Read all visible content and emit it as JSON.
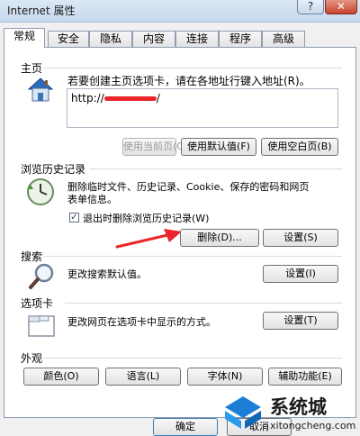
{
  "window": {
    "title": "Internet 属性",
    "help_glyph": "?",
    "close_glyph": "✕"
  },
  "tabs": [
    {
      "label": "常规",
      "active": true
    },
    {
      "label": "安全",
      "active": false
    },
    {
      "label": "隐私",
      "active": false
    },
    {
      "label": "内容",
      "active": false
    },
    {
      "label": "连接",
      "active": false
    },
    {
      "label": "程序",
      "active": false
    },
    {
      "label": "高级",
      "active": false
    }
  ],
  "homepage": {
    "title": "主页",
    "instruction": "若要创建主页选项卡，请在各地址行键入地址(R)。",
    "url_value": "http://",
    "url_suffix": "/",
    "buttons": {
      "use_current": "使用当前页(C)",
      "use_default": "使用默认值(F)",
      "use_blank": "使用空白页(B)"
    }
  },
  "history": {
    "title": "浏览历史记录",
    "description_line1": "删除临时文件、历史记录、Cookie、保存的密码和网页",
    "description_line2": "表单信息。",
    "checkbox_label": "退出时删除浏览历史记录(W)",
    "checkbox_checked": true,
    "checkmark": "✓",
    "buttons": {
      "delete": "删除(D)...",
      "settings": "设置(S)"
    }
  },
  "search": {
    "title": "搜索",
    "description": "更改搜索默认值。",
    "settings_button": "设置(I)"
  },
  "tabs_section": {
    "title": "选项卡",
    "description": "更改网页在选项卡中显示的方式。",
    "settings_button": "设置(T)"
  },
  "appearance": {
    "title": "外观",
    "buttons": {
      "colors": "颜色(O)",
      "languages": "语言(L)",
      "fonts": "字体(N)",
      "accessibility": "辅助功能(E)"
    }
  },
  "footer": {
    "ok": "确定",
    "cancel": "取消"
  },
  "watermark": {
    "brand": "系统城",
    "url": "xitongcheng.com"
  },
  "colors": {
    "annotation_red": "#e8262b",
    "watermark_blue": "#1a7fd4"
  }
}
